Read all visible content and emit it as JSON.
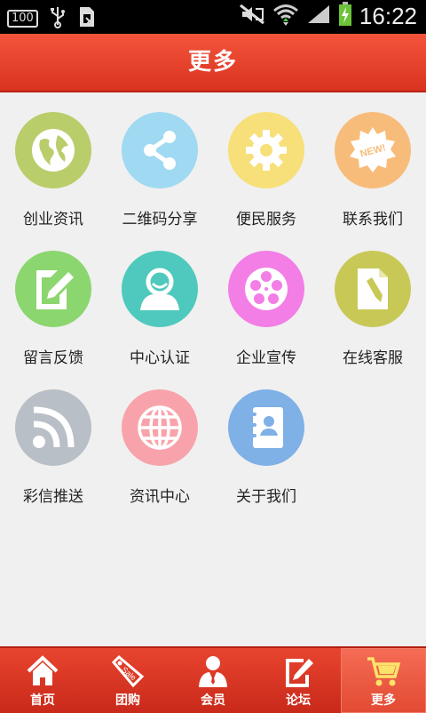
{
  "status_bar": {
    "battery_percent_badge": "100",
    "time": "16:22"
  },
  "header": {
    "title": "更多"
  },
  "grid": {
    "items": [
      {
        "label": "创业资讯",
        "icon": "globe-icon",
        "color": "#b9cd6a"
      },
      {
        "label": "二维码分享",
        "icon": "share-icon",
        "color": "#9fd9f2"
      },
      {
        "label": "便民服务",
        "icon": "gear-icon",
        "color": "#f7df7a"
      },
      {
        "label": "联系我们",
        "icon": "new-badge-icon",
        "color": "#f8bc7a"
      },
      {
        "label": "留言反馈",
        "icon": "edit-note-icon",
        "color": "#8bd66e"
      },
      {
        "label": "中心认证",
        "icon": "user-icon",
        "color": "#4fc9bd"
      },
      {
        "label": "企业宣传",
        "icon": "film-reel-icon",
        "color": "#f27ee6"
      },
      {
        "label": "在线客服",
        "icon": "document-pencil-icon",
        "color": "#c8c857"
      },
      {
        "label": "彩信推送",
        "icon": "rss-icon",
        "color": "#b9bfc7"
      },
      {
        "label": "资讯中心",
        "icon": "globe-grid-icon",
        "color": "#f8a3ab"
      },
      {
        "label": "关于我们",
        "icon": "contact-book-icon",
        "color": "#7fb0e6"
      }
    ]
  },
  "bottom_nav": {
    "items": [
      {
        "label": "首页",
        "icon": "home-icon"
      },
      {
        "label": "团购",
        "icon": "sale-tag-icon"
      },
      {
        "label": "会员",
        "icon": "member-icon"
      },
      {
        "label": "论坛",
        "icon": "forum-edit-icon"
      },
      {
        "label": "更多",
        "icon": "cart-icon"
      }
    ],
    "active_index": 4
  }
}
